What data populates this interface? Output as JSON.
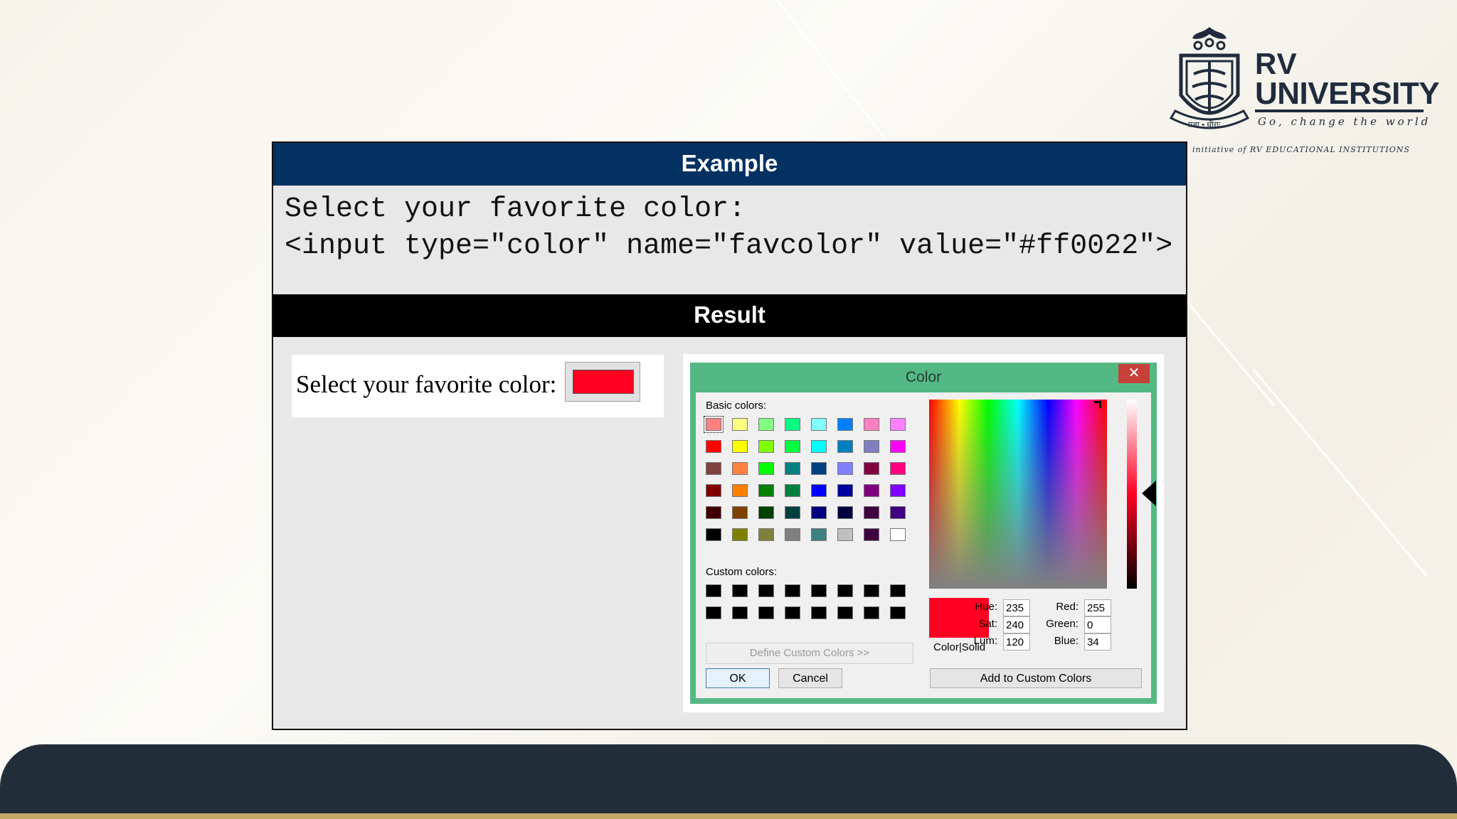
{
  "logo": {
    "line1": "RV",
    "line2": "UNIVERSITY",
    "tagline": "Go, change the world",
    "initiative": "initiative of RV EDUCATIONAL INSTITUTIONS",
    "seal_text": "प्रज्ञा • धीराः"
  },
  "example": {
    "header": "Example",
    "code_line1": "Select your favorite color:",
    "code_line2": "<input type=\"color\" name=\"favcolor\" value=\"#ff0022\">"
  },
  "result": {
    "header": "Result",
    "form_label": "Select your favorite color:",
    "input_value": "#ff0022"
  },
  "dialog": {
    "title": "Color",
    "close_glyph": "✕",
    "basic_label": "Basic colors:",
    "custom_label": "Custom colors:",
    "define_button": "Define Custom Colors >>",
    "ok_button": "OK",
    "cancel_button": "Cancel",
    "add_button": "Add to Custom Colors",
    "preview_label": "Color|Solid",
    "fields": {
      "hue_label": "Hue:",
      "hue": "235",
      "sat_label": "Sat:",
      "sat": "240",
      "lum_label": "Lum:",
      "lum": "120",
      "red_label": "Red:",
      "red": "255",
      "green_label": "Green:",
      "green": "0",
      "blue_label": "Blue:",
      "blue": "34"
    },
    "basic_colors": [
      "#ff8080",
      "#ffff80",
      "#80ff80",
      "#00ff80",
      "#80ffff",
      "#0080ff",
      "#ff80c0",
      "#ff80ff",
      "#ff0000",
      "#ffff00",
      "#80ff00",
      "#00ff40",
      "#00ffff",
      "#0080c0",
      "#8080c0",
      "#ff00ff",
      "#804040",
      "#ff8040",
      "#00ff00",
      "#008080",
      "#004080",
      "#8080ff",
      "#800040",
      "#ff0080",
      "#800000",
      "#ff8000",
      "#008000",
      "#008040",
      "#0000ff",
      "#0000a0",
      "#800080",
      "#8000ff",
      "#400000",
      "#804000",
      "#004000",
      "#004040",
      "#000080",
      "#000040",
      "#400040",
      "#400080",
      "#000000",
      "#808000",
      "#808040",
      "#808080",
      "#408080",
      "#c0c0c0",
      "#400040",
      "#ffffff"
    ],
    "custom_colors": [
      "#000000",
      "#000000",
      "#000000",
      "#000000",
      "#000000",
      "#000000",
      "#000000",
      "#000000",
      "#000000",
      "#000000",
      "#000000",
      "#000000",
      "#000000",
      "#000000",
      "#000000",
      "#000000"
    ],
    "selected_color": "#ff0022"
  },
  "colors": {
    "example_header_bg": "#033162",
    "result_header_bg": "#000000",
    "dialog_frame": "#54b885",
    "footer_bg": "#222d3a",
    "footer_accent": "#c4a962"
  }
}
